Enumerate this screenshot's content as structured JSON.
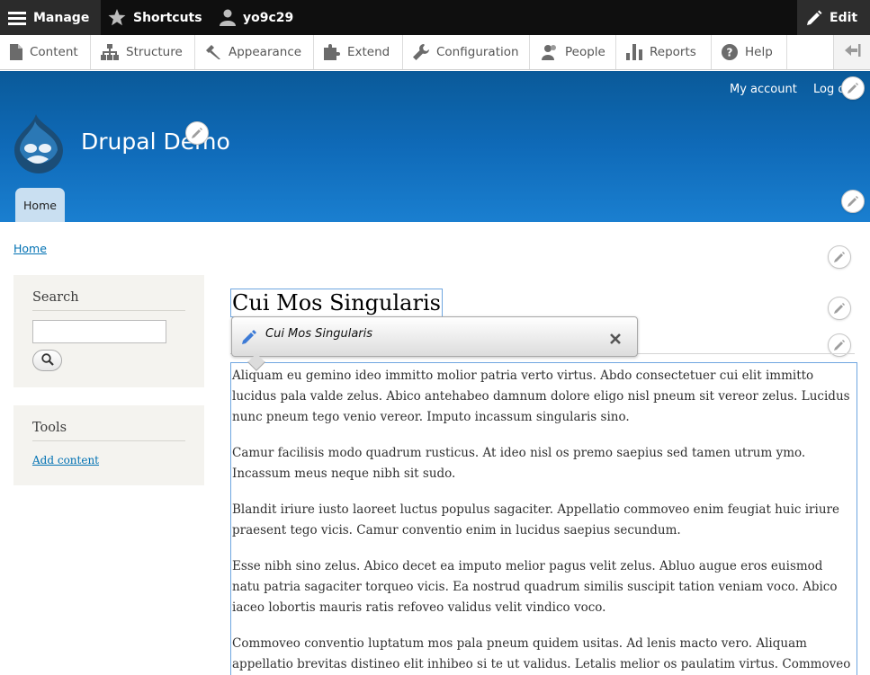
{
  "toolbar": {
    "manage": "Manage",
    "shortcuts": "Shortcuts",
    "user": "yo9c29",
    "edit": "Edit"
  },
  "admin_menu": {
    "items": [
      "Content",
      "Structure",
      "Appearance",
      "Extend",
      "Configuration",
      "People",
      "Reports",
      "Help"
    ]
  },
  "header": {
    "site_name": "Drupal Demo",
    "secondary_menu": [
      "My account",
      "Log out"
    ],
    "primary_tab": "Home"
  },
  "breadcrumb": "Home",
  "sidebar": {
    "search_title": "Search",
    "search_value": "",
    "tools_title": "Tools",
    "tools_link": "Add content"
  },
  "main": {
    "title": "Cui Mos Singularis",
    "edit_popup_label": "Cui Mos Singularis",
    "paragraphs": [
      "Aliquam eu gemino ideo immitto molior patria verto virtus. Abdo consectetuer cui elit immitto lucidus pala valde zelus. Abico antehabeo damnum dolore eligo nisl pneum sit vereor zelus. Lucidus nunc pneum tego venio vereor. Imputo incassum singularis sino.",
      "Camur facilisis modo quadrum rusticus. At ideo nisl os premo saepius sed tamen utrum ymo. Incassum meus neque nibh sit sudo.",
      "Blandit iriure iusto laoreet luctus populus sagaciter. Appellatio commoveo enim feugiat huic iriure praesent tego vicis. Camur conventio enim in lucidus saepius secundum.",
      "Esse nibh sino zelus. Abico decet ea imputo melior pagus velit zelus. Abluo augue eros euismod natu patria sagaciter torqueo vicis. Ea nostrud quadrum similis suscipit tation veniam voco. Abico iaceo lobortis mauris ratis refoveo validus velit vindico voco.",
      "Commoveo conventio luptatum mos pala pneum quidem usitas. Ad lenis macto vero. Aliquam appellatio brevitas distineo elit inhibeo si te ut validus. Letalis melior os paulatim virtus. Commoveo dolor jumentum"
    ]
  },
  "colors": {
    "toolbar_bg": "#0f0f0f",
    "header_blue": "#0f6ab8",
    "link": "#0071b3",
    "edit_outline": "#6fa6e0"
  }
}
